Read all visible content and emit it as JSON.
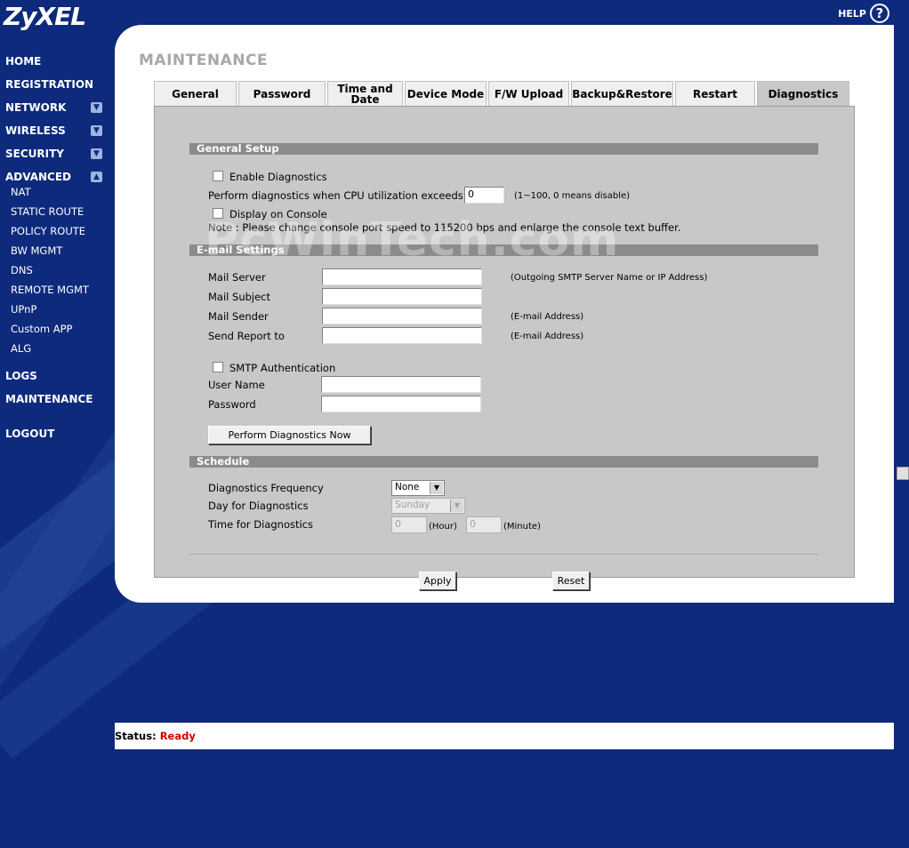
{
  "brand": {
    "logo": "ZyXEL",
    "help_label": "HELP",
    "help_icon": "?"
  },
  "nav": {
    "home": "HOME",
    "registration": "REGISTRATION",
    "network": "NETWORK",
    "wireless": "WIRELESS",
    "security": "SECURITY",
    "advanced": "ADVANCED",
    "advanced_items": [
      "NAT",
      "STATIC ROUTE",
      "POLICY ROUTE",
      "BW MGMT",
      "DNS",
      "REMOTE MGMT",
      "UPnP",
      "Custom APP",
      "ALG"
    ],
    "logs": "LOGS",
    "maintenance": "MAINTENANCE",
    "logout": "LOGOUT"
  },
  "page": {
    "title": "MAINTENANCE"
  },
  "tabs": [
    "General",
    "Password",
    "Time and Date",
    "Device Mode",
    "F/W Upload",
    "Backup&Restore",
    "Restart",
    "Diagnostics"
  ],
  "active_tab": "Diagnostics",
  "general_setup": {
    "heading": "General Setup",
    "enable_label": "Enable Diagnostics",
    "cpu_label": "Perform diagnostics when CPU utilization exceeds",
    "cpu_value": "0",
    "cpu_hint": "(1~100, 0 means disable)",
    "console_label": "Display on Console",
    "note": "Note : Please change console port speed to 115200 bps and enlarge the console text buffer."
  },
  "email": {
    "heading": "E-mail Settings",
    "mail_server": "Mail Server",
    "mail_server_hint": "(Outgoing SMTP Server Name or IP Address)",
    "mail_subject": "Mail Subject",
    "mail_sender": "Mail Sender",
    "mail_sender_hint": "(E-mail Address)",
    "send_report": "Send Report to",
    "send_report_hint": "(E-mail Address)",
    "smtp_auth": "SMTP Authentication",
    "user_name": "User Name",
    "password": "Password",
    "perform_button": "Perform Diagnostics Now"
  },
  "schedule": {
    "heading": "Schedule",
    "frequency_label": "Diagnostics Frequency",
    "frequency_value": "None",
    "day_label": "Day for Diagnostics",
    "day_value": "Sunday",
    "time_label": "Time for Diagnostics",
    "hour_value": "0",
    "hour_unit": "(Hour)",
    "minute_value": "0",
    "minute_unit": "(Minute)"
  },
  "buttons": {
    "apply": "Apply",
    "reset": "Reset"
  },
  "status": {
    "label": "Status:",
    "value": "Ready"
  },
  "watermark": "PcWinTech.com",
  "colors": {
    "background": "#0d2a7c",
    "section_bar": "#8b8b8b",
    "status_ready": "#d00000"
  }
}
